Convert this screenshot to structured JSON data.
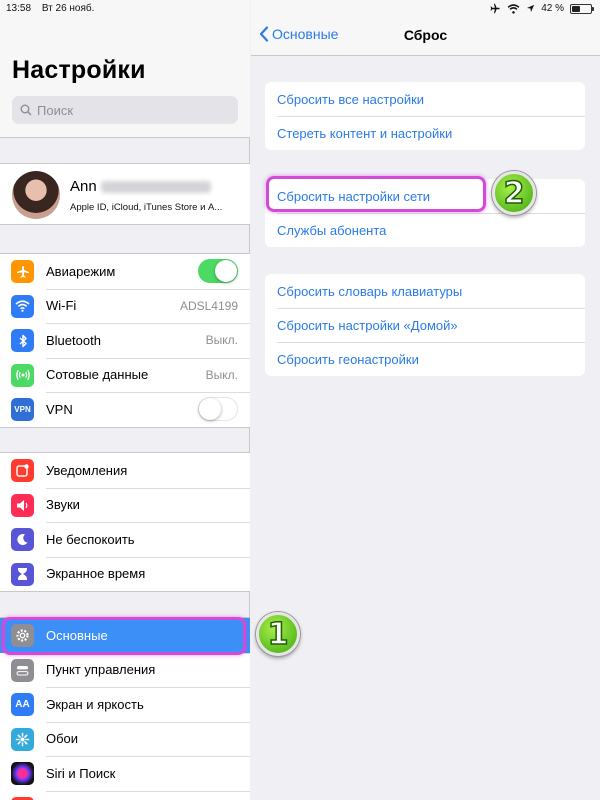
{
  "status": {
    "time": "13:58",
    "date": "Вт 26 нояб.",
    "battery": "42 %"
  },
  "left": {
    "title": "Настройки",
    "search_placeholder": "Поиск",
    "profile": {
      "name": "Ann",
      "subtitle": "Apple ID, iCloud, iTunes Store и А..."
    },
    "group1": [
      {
        "label": "Авиарежим",
        "toggle": "on",
        "icon": "airplane-icon",
        "color": "#ff9500"
      },
      {
        "label": "Wi-Fi",
        "value": "ADSL4199",
        "icon": "wifi-icon",
        "color": "#2f7cf6"
      },
      {
        "label": "Bluetooth",
        "value": "Выкл.",
        "icon": "bluetooth-icon",
        "color": "#2f7cf6"
      },
      {
        "label": "Сотовые данные",
        "value": "Выкл.",
        "icon": "cellular-icon",
        "color": "#4cd964"
      },
      {
        "label": "VPN",
        "toggle": "off",
        "icon": "vpn-icon",
        "color": "#2f6fd6"
      }
    ],
    "group2": [
      {
        "label": "Уведомления",
        "icon": "notifications-icon",
        "color": "#ff3b30"
      },
      {
        "label": "Звуки",
        "icon": "sounds-icon",
        "color": "#ff2d55"
      },
      {
        "label": "Не беспокоить",
        "icon": "moon-icon",
        "color": "#5856d6"
      },
      {
        "label": "Экранное время",
        "icon": "hourglass-icon",
        "color": "#5856d6"
      }
    ],
    "group3": [
      {
        "label": "Основные",
        "icon": "gear-icon",
        "color": "#8e8e93",
        "selected": true
      },
      {
        "label": "Пункт управления",
        "icon": "control-center-icon",
        "color": "#8e8e93"
      },
      {
        "label": "Экран и яркость",
        "icon": "display-icon",
        "color": "#2f7cf6"
      },
      {
        "label": "Обои",
        "icon": "wallpaper-icon",
        "color": "#34aadc"
      },
      {
        "label": "Siri и Поиск",
        "icon": "siri-icon",
        "color": "#1c1c1e"
      }
    ]
  },
  "right": {
    "back_label": "Основные",
    "title": "Сброс",
    "group1": [
      "Сбросить все настройки",
      "Стереть контент и настройки"
    ],
    "group2": [
      "Сбросить настройки сети",
      "Службы абонента"
    ],
    "group3": [
      "Сбросить словарь клавиатуры",
      "Сбросить настройки «Домой»",
      "Сбросить геонастройки"
    ]
  },
  "annotations": {
    "step1": "1",
    "step2": "2"
  }
}
